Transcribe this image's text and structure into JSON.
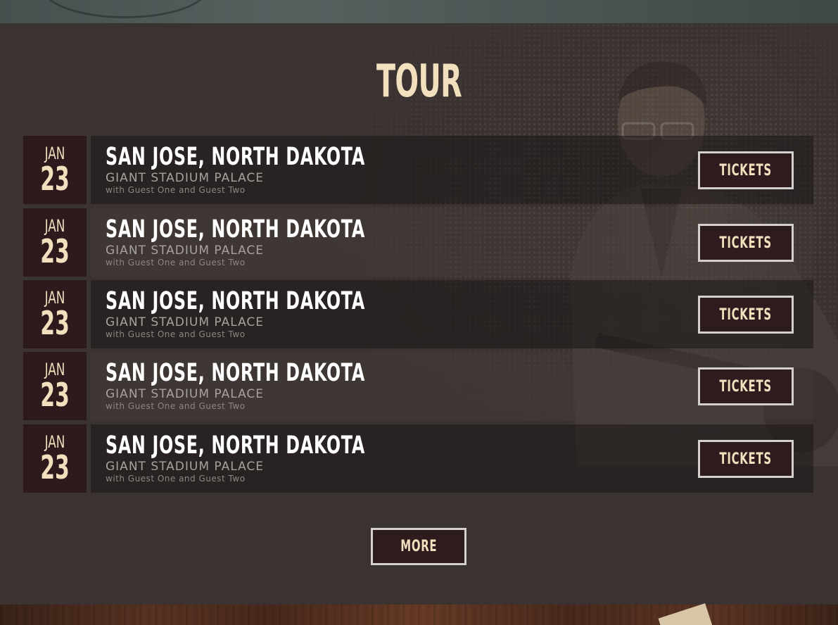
{
  "tour": {
    "title": "TOUR",
    "shows": [
      {
        "month": "JAN",
        "day": "23",
        "city": "SAN JOSE, NORTH DAKOTA",
        "venue": "GIANT STADIUM PALACE",
        "guests": "with Guest One and Guest Two",
        "tickets_label": "TICKETS"
      },
      {
        "month": "JAN",
        "day": "23",
        "city": "SAN JOSE, NORTH DAKOTA",
        "venue": "GIANT STADIUM PALACE",
        "guests": "with Guest One and Guest Two",
        "tickets_label": "TICKETS"
      },
      {
        "month": "JAN",
        "day": "23",
        "city": "SAN JOSE, NORTH DAKOTA",
        "venue": "GIANT STADIUM PALACE",
        "guests": "with Guest One and Guest Two",
        "tickets_label": "TICKETS"
      },
      {
        "month": "JAN",
        "day": "23",
        "city": "SAN JOSE, NORTH DAKOTA",
        "venue": "GIANT STADIUM PALACE",
        "guests": "with Guest One and Guest Two",
        "tickets_label": "TICKETS"
      },
      {
        "month": "JAN",
        "day": "23",
        "city": "SAN JOSE, NORTH DAKOTA",
        "venue": "GIANT STADIUM PALACE",
        "guests": "with Guest One and Guest Two",
        "tickets_label": "TICKETS"
      }
    ],
    "more_label": "MORE"
  },
  "colors": {
    "accent_cream": "#f1dfbe",
    "date_box_bg": "#2c1a1d",
    "section_bg": "#3b3331",
    "button_border": "#d3d0cf"
  }
}
